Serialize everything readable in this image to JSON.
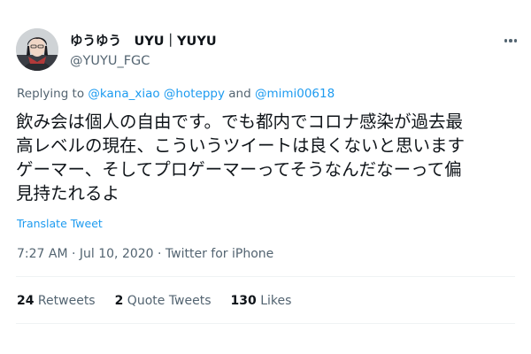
{
  "tweet": {
    "author": {
      "display_name": "ゆうゆう　UYU｜YUYU",
      "handle": "@YUYU_FGC"
    },
    "reply": {
      "prefix": "Replying to ",
      "mentions": [
        "@kana_xiao",
        "@hoteppy",
        "@mimi00618"
      ],
      "separator_1": " ",
      "separator_2": " and "
    },
    "text_lines": [
      "飲み会は個人の自由です。でも都内でコロナ感染が過去最",
      "高レベルの現在、こういうツイートは良くないと思います",
      "ゲーマー、そしてプロゲーマーってそうなんだなーって偏",
      "見持たれるよ"
    ],
    "translate_label": "Translate Tweet",
    "timestamp": "7:27 AM · Jul 10, 2020 · Twitter for iPhone",
    "stats": {
      "retweets_count": "24",
      "retweets_label": " Retweets",
      "quotes_count": "2",
      "quotes_label": " Quote Tweets",
      "likes_count": "130",
      "likes_label": " Likes"
    }
  },
  "colors": {
    "link": "#1d9bf0",
    "secondary_text": "#536471",
    "primary_text": "#0f1419",
    "divider": "#eff3f4"
  },
  "icons": {
    "more": "more-dots-icon",
    "avatar": "avatar"
  }
}
